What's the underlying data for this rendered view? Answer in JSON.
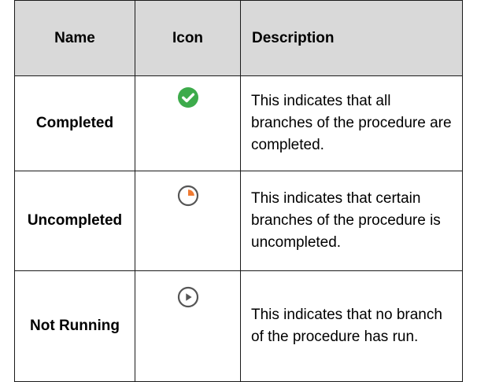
{
  "table": {
    "headers": [
      "Name",
      "Icon",
      "Description"
    ],
    "rows": [
      {
        "name": "Completed",
        "icon": "check-circle-icon",
        "description": "This indicates that all branches of the procedure are completed."
      },
      {
        "name": "Uncompleted",
        "icon": "partial-progress-icon",
        "description": "This indicates that certain branches of the procedure is uncompleted."
      },
      {
        "name": "Not Running",
        "icon": "play-circle-icon",
        "description": "This indicates that no branch of the procedure has run."
      }
    ]
  },
  "colors": {
    "header_background": "#d9d9d9",
    "completed_green": "#3dab4b",
    "uncompleted_orange": "#f07a32",
    "icon_gray": "#555555"
  }
}
